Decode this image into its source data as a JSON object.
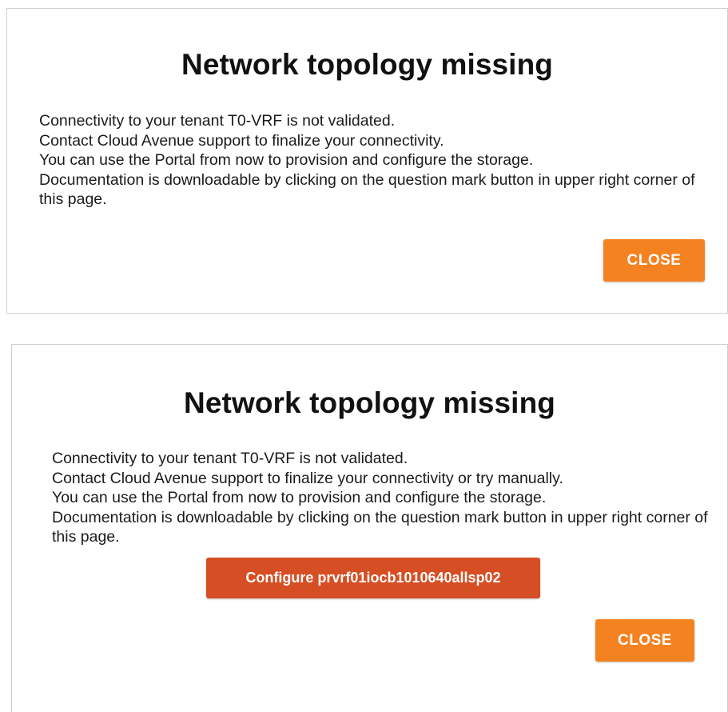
{
  "dialogs": [
    {
      "title": "Network topology missing",
      "lines": [
        "Connectivity to your tenant T0-VRF is not validated.",
        "Contact Cloud Avenue support to finalize your connectivity.",
        "You can use the Portal from now to provision and configure the storage.",
        "Documentation is downloadable by clicking on the question mark button in upper right corner of this page."
      ],
      "close_label": "CLOSE"
    },
    {
      "title": "Network topology missing",
      "lines": [
        "Connectivity to your tenant T0-VRF is not validated.",
        "Contact Cloud Avenue support to finalize your connectivity or try manually.",
        "You can use the Portal from now to provision and configure the storage.",
        "Documentation is downloadable by clicking on the question mark button in upper right corner of this page."
      ],
      "configure_label": "Configure prvrf01iocb1010640allsp02",
      "close_label": "CLOSE"
    }
  ],
  "colors": {
    "close_button": "#f58220",
    "configure_button": "#d64e24",
    "border": "#cfcfcf"
  }
}
